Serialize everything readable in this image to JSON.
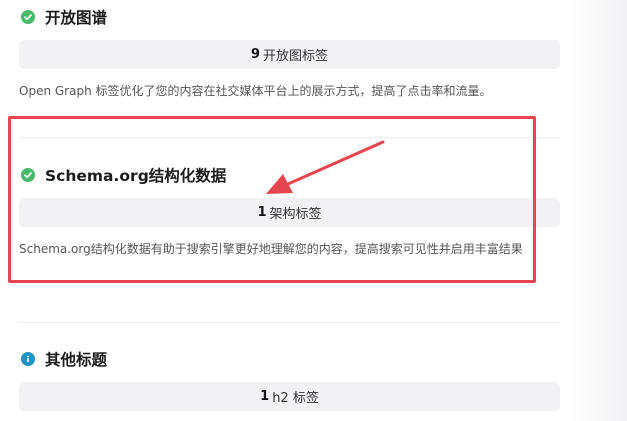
{
  "sections": [
    {
      "title": "开放图谱",
      "status_icon": "check-circle-icon",
      "pill_count": "9",
      "pill_label": "开放图标签",
      "description": "Open Graph 标签优化了您的内容在社交媒体平台上的展示方式，提高了点击率和流量。"
    },
    {
      "title": "Schema.org结构化数据",
      "status_icon": "check-circle-icon",
      "pill_count": "1",
      "pill_label": "架构标签",
      "description": "Schema.org结构化数据有助于搜索引擎更好地理解您的内容，提高搜索可见性并启用丰富结果"
    },
    {
      "title": "其他标题",
      "status_icon": "info-circle-icon",
      "pill_count": "1",
      "pill_label": "h2 标签"
    }
  ],
  "colors": {
    "success": "#49b96b",
    "info": "#1f93c4",
    "annotation_red": "#e5454e",
    "pill_bg": "#f2f2f4"
  }
}
